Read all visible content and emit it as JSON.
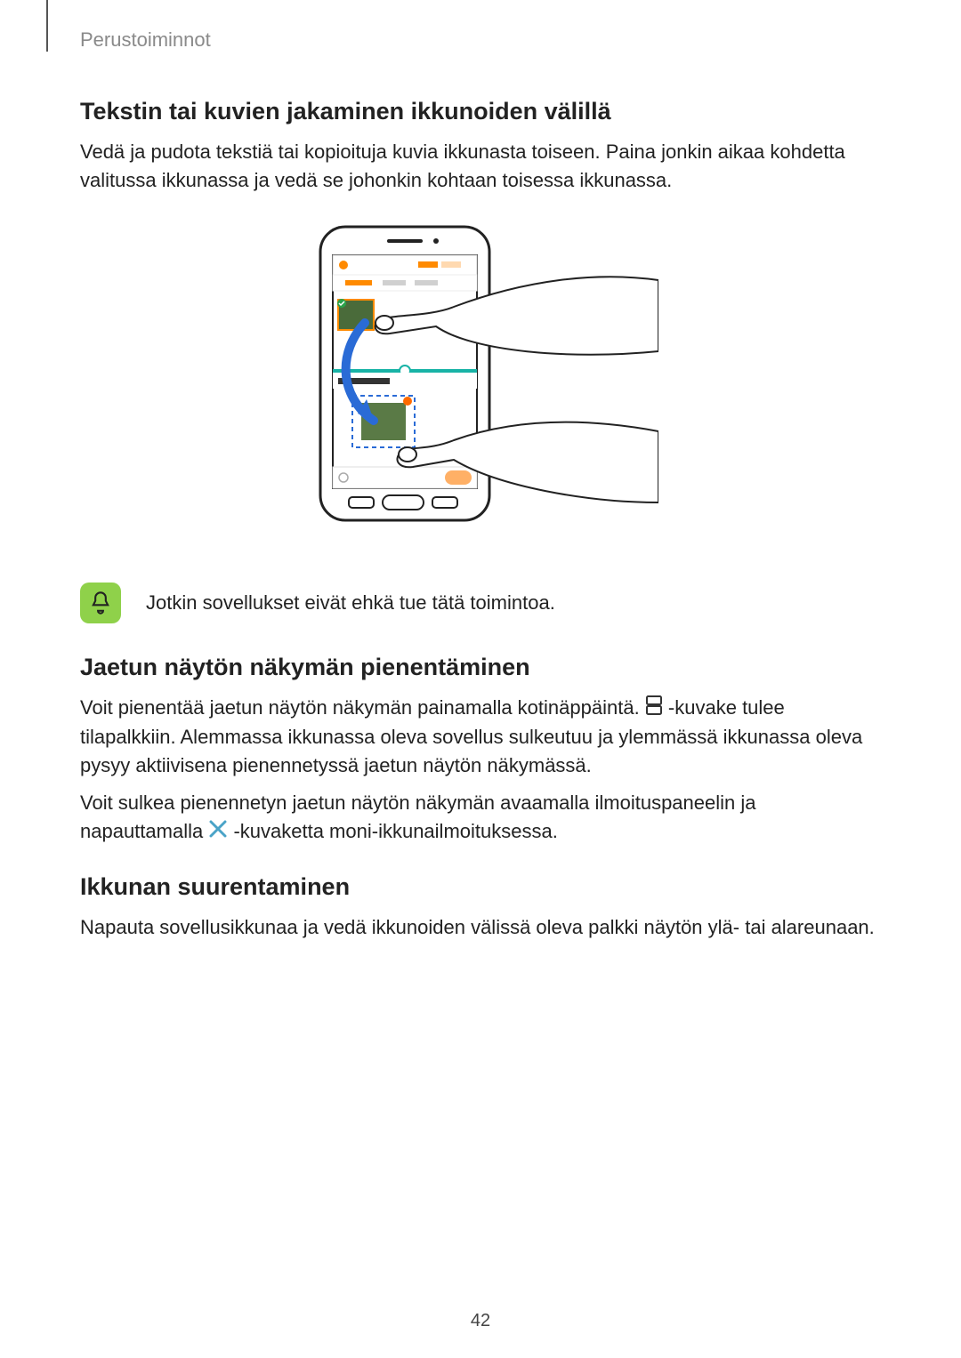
{
  "running_head": "Perustoiminnot",
  "section1": {
    "heading": "Tekstin tai kuvien jakaminen ikkunoiden välillä",
    "para": "Vedä ja pudota tekstiä tai kopioituja kuvia ikkunasta toiseen. Paina jonkin aikaa kohdetta valitussa ikkunassa ja vedä se johonkin kohtaan toisessa ikkunassa."
  },
  "note": {
    "text": "Jotkin sovellukset eivät ehkä tue tätä toimintoa."
  },
  "section2": {
    "heading": "Jaetun näytön näkymän pienentäminen",
    "para1a": "Voit pienentää jaetun näytön näkymän painamalla kotinäppäintä. ",
    "para1b": " -kuvake tulee tilapalkkiin. Alemmassa ikkunassa oleva sovellus sulkeutuu ja ylemmässä ikkunassa oleva pysyy aktiivisena pienennetyssä jaetun näytön näkymässä.",
    "para2a": "Voit sulkea pienennetyn jaetun näytön näkymän avaamalla ilmoituspaneelin ja napauttamalla ",
    "para2b": " -kuvaketta moni-ikkunailmoituksessa."
  },
  "section3": {
    "heading": "Ikkunan suurentaminen",
    "para": "Napauta sovellusikkunaa ja vedä ikkunoiden välissä oleva palkki näytön ylä- tai alareunaan."
  },
  "page_number": "42"
}
